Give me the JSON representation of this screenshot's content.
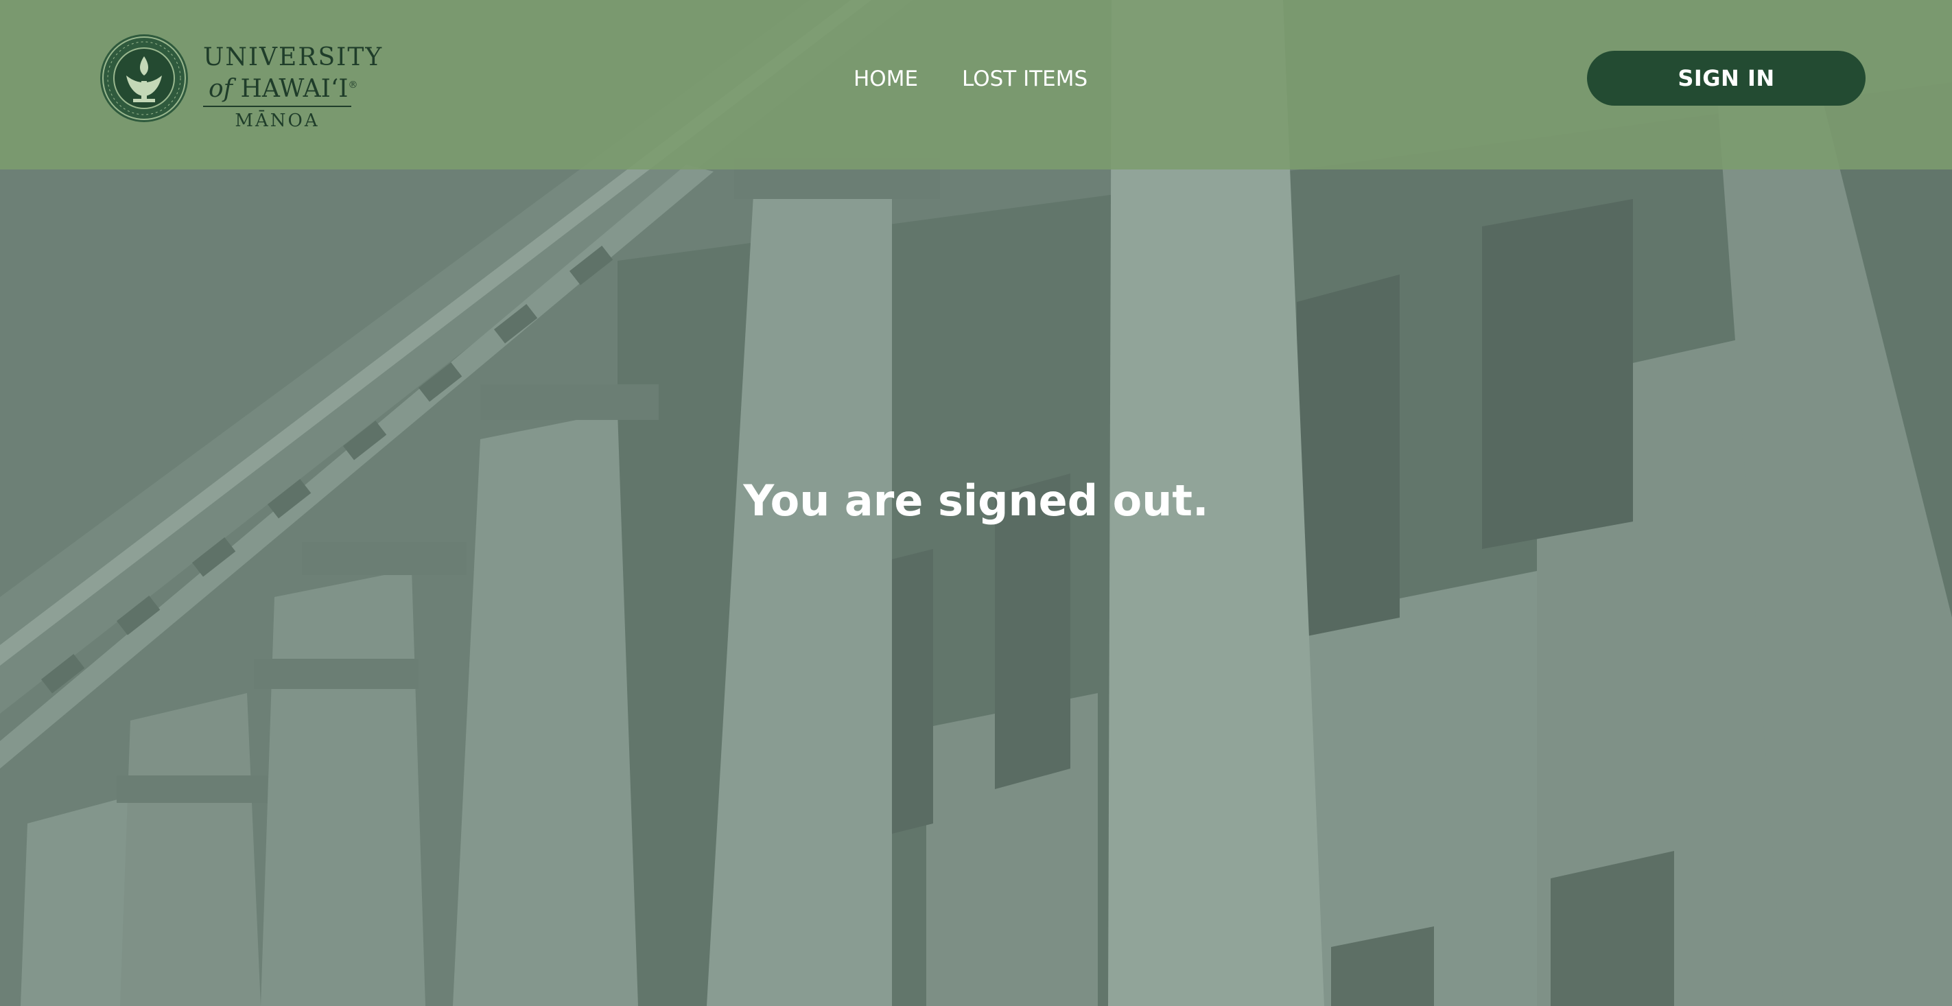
{
  "header": {
    "logo": {
      "line1": "UNIVERSITY",
      "line2_of": "of",
      "line2_name": "HAWAIʻI",
      "line2_mark": "®",
      "line3": "MĀNOA",
      "seal_icon": "university-seal-icon"
    },
    "nav": [
      {
        "label": "HOME"
      },
      {
        "label": "LOST ITEMS"
      }
    ],
    "sign_in_label": "SIGN IN"
  },
  "main": {
    "message": "You are signed out."
  },
  "colors": {
    "navbar": "#7c9c6e",
    "button": "#234b32",
    "overlay": "#76887f",
    "text_light": "#ffffff",
    "logo_dark": "#1f3d2a"
  }
}
